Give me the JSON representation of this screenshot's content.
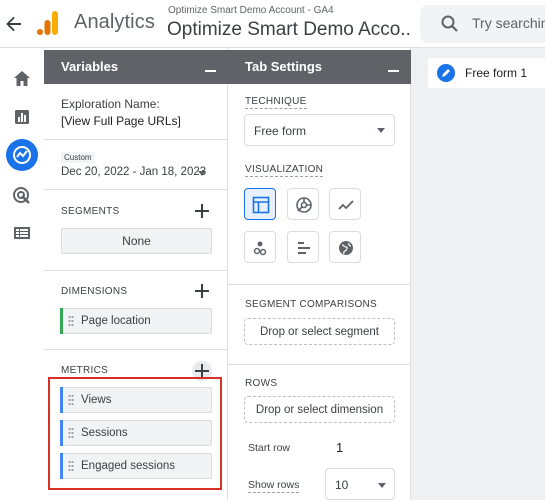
{
  "topbar": {
    "app_name": "Analytics",
    "account_path": "Optimize Smart Demo Account - GA4",
    "property_name": "Optimize Smart Demo Acco...",
    "search_placeholder": "Try searchin"
  },
  "leftnav": {
    "items": [
      {
        "name": "home-icon",
        "label": "Home"
      },
      {
        "name": "reports-icon",
        "label": "Reports"
      },
      {
        "name": "explore-icon",
        "label": "Explore",
        "active": true
      },
      {
        "name": "advertising-icon",
        "label": "Advertising"
      },
      {
        "name": "configure-icon",
        "label": "Configure"
      }
    ]
  },
  "variables": {
    "header": "Variables",
    "exploration_label": "Exploration Name:",
    "exploration_name": "[View Full Page URLs]",
    "date_tag": "Custom",
    "date_range": "Dec 20, 2022 - Jan 18, 2023",
    "segments_title": "SEGMENTS",
    "segments_empty": "None",
    "dimensions_title": "DIMENSIONS",
    "dimensions": [
      "Page location"
    ],
    "metrics_title": "METRICS",
    "metrics": [
      "Views",
      "Sessions",
      "Engaged sessions"
    ]
  },
  "tab_settings": {
    "header": "Tab Settings",
    "technique_title": "TECHNIQUE",
    "technique_value": "Free form",
    "visualization_title": "VISUALIZATION",
    "visualizations": [
      "table-icon",
      "donut-chart-icon",
      "line-chart-icon",
      "scatter-plot-icon",
      "bar-chart-icon",
      "geo-map-icon"
    ],
    "selected_visualization": "table-icon",
    "segment_comparisons_title": "SEGMENT COMPARISONS",
    "segment_drop": "Drop or select segment",
    "rows_title": "ROWS",
    "rows_drop": "Drop or select dimension",
    "start_row_label": "Start row",
    "start_row_value": "1",
    "show_rows_label": "Show rows",
    "show_rows_value": "10"
  },
  "canvas": {
    "tab_label": "Free form 1"
  },
  "colors": {
    "accent": "#1a73e8",
    "panel_header": "#5f6368",
    "highlight": "#d93025",
    "dimension_bar": "#34a853",
    "metric_bar": "#4285f4"
  }
}
